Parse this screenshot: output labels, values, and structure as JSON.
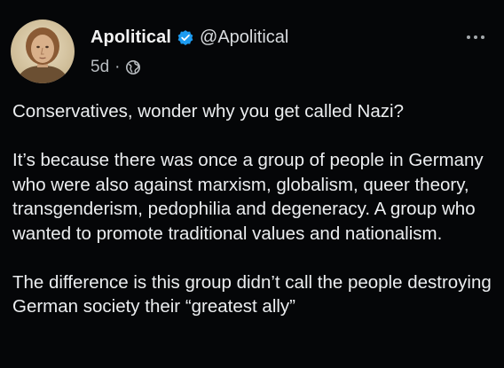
{
  "post": {
    "author": {
      "display_name": "Apolitical",
      "handle": "@Apolitical",
      "verified_icon": "verified-badge-icon",
      "avatar_icon": "profile-portrait"
    },
    "meta": {
      "time": "5d",
      "separator": "·",
      "visibility_icon": "globe-icon"
    },
    "menu_icon": "more-options-icon",
    "paragraphs": [
      "Conservatives, wonder why you get called Nazi?",
      "It’s because there was once a group of people in Germany who were also against marxism, globalism, queer theory, transgenderism, pedophilia and degeneracy. A group who wanted to promote traditional values and nationalism.",
      "The difference is this group didn’t call the people destroying German society their “greatest ally”"
    ]
  },
  "colors": {
    "background": "#050608",
    "text": "#eceef0",
    "muted": "#b8bcc0",
    "verified": "#1d9bf0"
  }
}
